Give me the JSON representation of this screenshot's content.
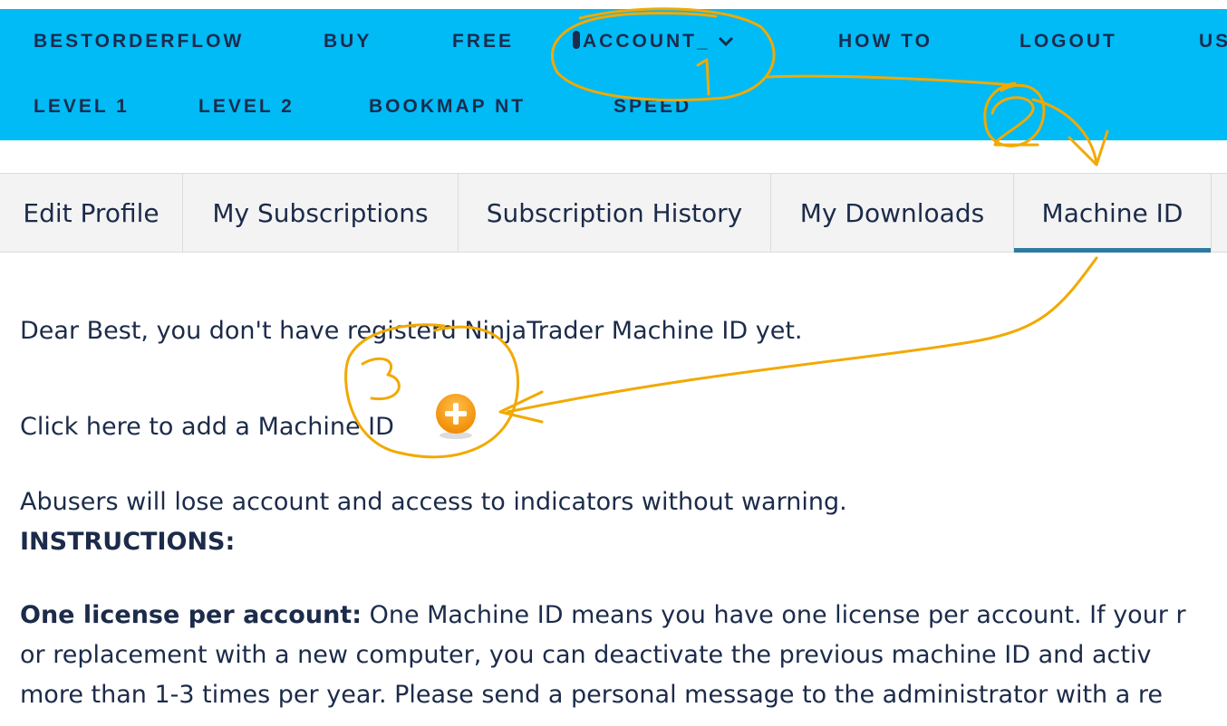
{
  "nav": {
    "row1": [
      "BESTORDERFLOW",
      "BUY",
      "FREE",
      "ACCOUNT_",
      "HOW TO",
      "LOGOUT",
      "US"
    ],
    "row2": [
      "LEVEL 1",
      "LEVEL 2",
      "BOOKMAP NT",
      "SPEED"
    ]
  },
  "tabs": [
    "Edit Profile",
    "My Subscriptions",
    "Subscription History",
    "My Downloads",
    "Machine ID"
  ],
  "active_tab": "Machine ID",
  "main": {
    "notice": "Dear Best, you don't have registerd NinjaTrader Machine ID yet.",
    "add_prompt": "Click here to add a Machine ID",
    "warning": "Abusers will lose account and access to indicators without warning.",
    "instructions_heading": "INSTRUCTIONS:",
    "license_label": "One license per account:",
    "license_line1": " One Machine ID means you have one license per account. If your r",
    "license_line2": "or replacement with a new computer, you can deactivate the previous machine ID and activ",
    "license_line3": "more than 1-3 times per year. Please send a personal message to the administrator with a re"
  },
  "annotations": [
    "1",
    "2",
    "3"
  ],
  "colors": {
    "nav_bg": "#00bbf5",
    "nav_text": "#1b2c4f",
    "text": "#1c2b4a",
    "tab_active_underline": "#2d7aa0",
    "annotation": "#f2a900",
    "add_button": "#f59a0c"
  }
}
